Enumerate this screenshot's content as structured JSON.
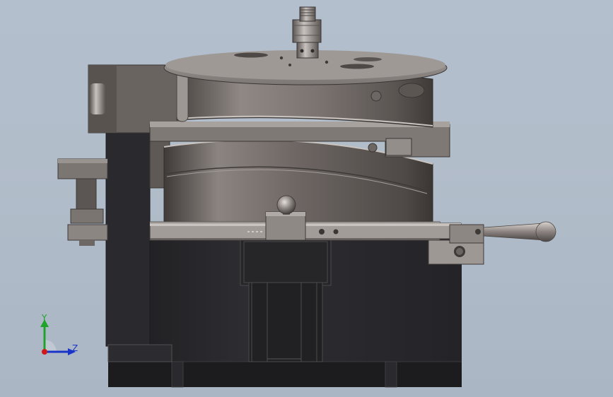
{
  "view": {
    "type": "3d-cad-viewport",
    "background_top": "#b3bfcd",
    "background_bottom": "#aab6c4"
  },
  "triad": {
    "y_label": "Y",
    "z_label": "Z",
    "y_color": "#1fa32b",
    "z_color": "#1a33c8",
    "x_color": "#d01818"
  },
  "model": {
    "metal_color": "#8a8380",
    "dark_color": "#2c2c30",
    "mid_color": "#5e5955"
  }
}
